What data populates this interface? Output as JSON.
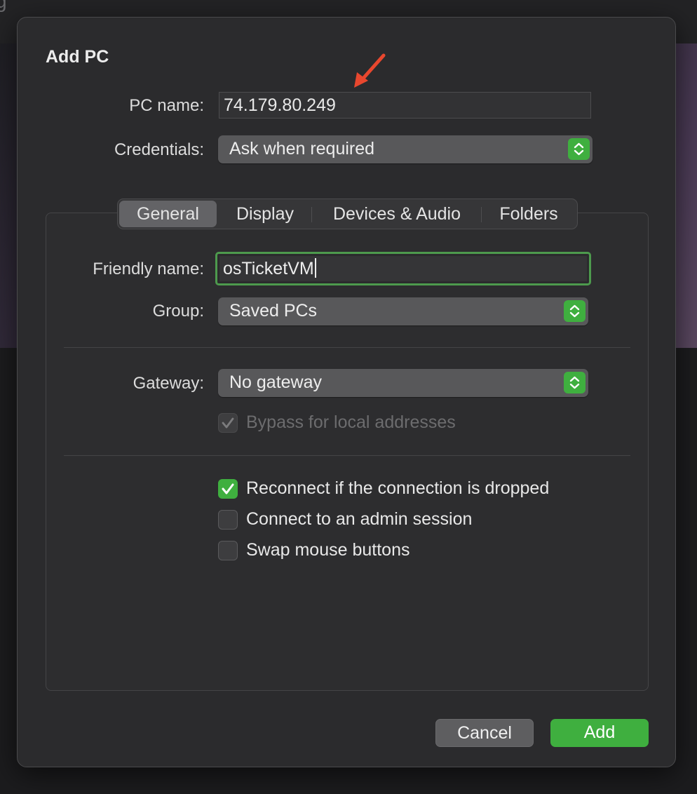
{
  "background": {
    "corner_glyph": "g"
  },
  "dialog": {
    "title": "Add PC",
    "pc_name": {
      "label": "PC name:",
      "value": "74.179.80.249"
    },
    "credentials": {
      "label": "Credentials:",
      "value": "Ask when required"
    },
    "tabs": [
      {
        "label": "General",
        "selected": true
      },
      {
        "label": "Display",
        "selected": false
      },
      {
        "label": "Devices & Audio",
        "selected": false
      },
      {
        "label": "Folders",
        "selected": false
      }
    ],
    "general": {
      "friendly_name": {
        "label": "Friendly name:",
        "value": "osTicketVM"
      },
      "group": {
        "label": "Group:",
        "value": "Saved PCs"
      },
      "gateway": {
        "label": "Gateway:",
        "value": "No gateway"
      },
      "bypass": {
        "label": "Bypass for local addresses",
        "checked": true,
        "enabled": false
      },
      "options": [
        {
          "label": "Reconnect if the connection is dropped",
          "checked": true
        },
        {
          "label": "Connect to an admin session",
          "checked": false
        },
        {
          "label": "Swap mouse buttons",
          "checked": false
        }
      ]
    },
    "buttons": {
      "cancel": "Cancel",
      "add": "Add"
    }
  },
  "colors": {
    "accent": "#3faf3f",
    "annotation_arrow": "#e8472e",
    "dialog_bg": "#2b2b2d",
    "popup_bg": "#58585a"
  },
  "icons": {
    "stepper": "chevron-up-down-icon",
    "check": "checkmark-icon",
    "annotation": "red-arrow-icon"
  }
}
